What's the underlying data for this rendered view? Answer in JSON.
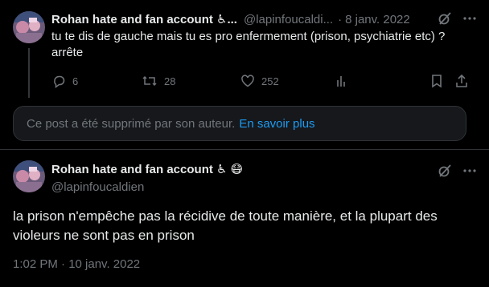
{
  "reply_parent": {
    "display_name": "Rohan hate and fan account ♿...",
    "handle": "@lapinfoucaldi...",
    "dot": "·",
    "date": "8 janv. 2022",
    "text_line1": "tu te dis de gauche mais tu es pro enfermement (prison, psychiatrie etc) ?",
    "text_line2": "arrête",
    "replies": "6",
    "retweets": "28",
    "likes": "252"
  },
  "deleted_notice": {
    "text": "Ce post a été supprimé par son auteur.",
    "link": "En savoir plus"
  },
  "main_tweet": {
    "display_name": "Rohan hate and fan account ♿",
    "emoji": "😷",
    "handle": "@lapinfoucaldien",
    "text": "la prison n'empêche pas la récidive de toute manière, et la plupart des violeurs ne sont pas en prison",
    "timestamp": "1:02 PM · 10 janv. 2022"
  },
  "colors": {
    "background": "#000000",
    "text": "#e7e9ea",
    "muted": "#71767b",
    "link": "#1d9bf0",
    "border": "#2f3336"
  }
}
